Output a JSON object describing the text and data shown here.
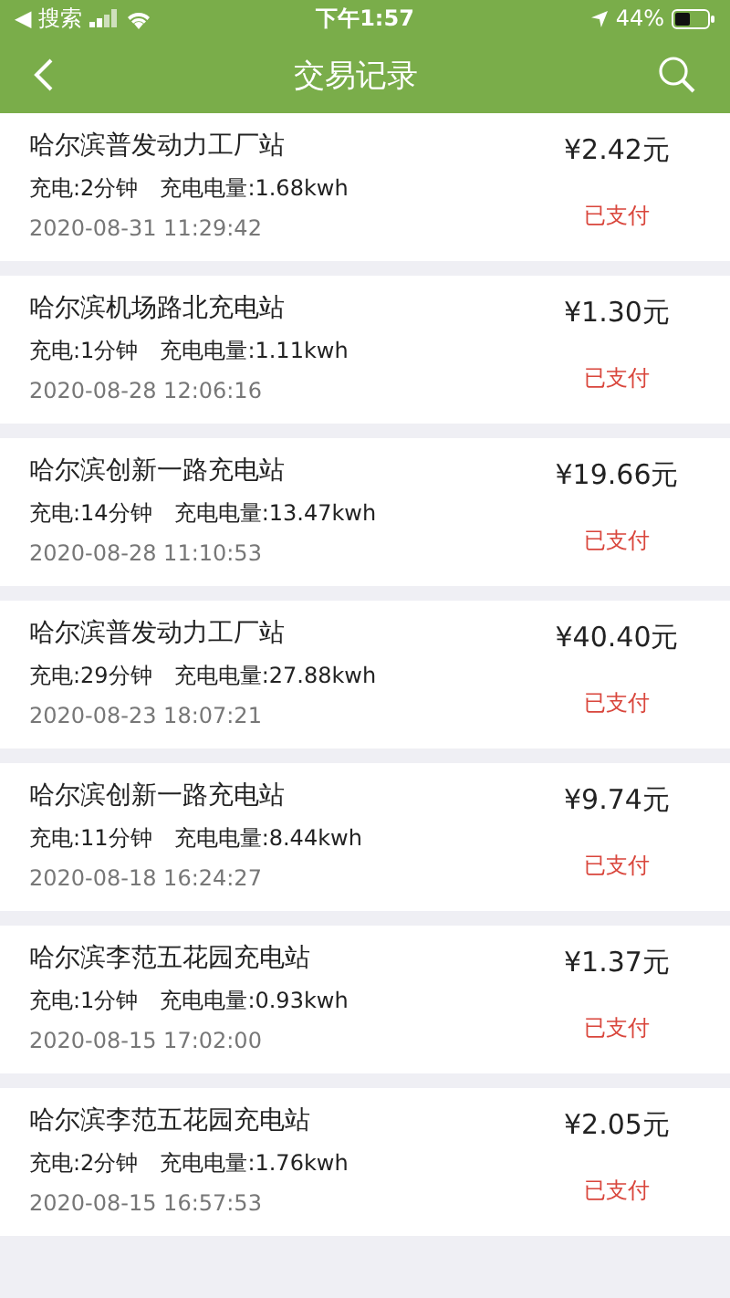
{
  "status_bar": {
    "back_label": "◀ 搜索",
    "time": "下午1:57",
    "battery": "44%"
  },
  "nav": {
    "title": "交易记录"
  },
  "records": [
    {
      "station": "哈尔滨普发动力工厂站",
      "duration": "充电:2分钟",
      "energy": "充电电量:1.68kwh",
      "time": "2020-08-31 11:29:42",
      "amount": "¥2.42元",
      "status": "已支付"
    },
    {
      "station": "哈尔滨机场路北充电站",
      "duration": "充电:1分钟",
      "energy": "充电电量:1.11kwh",
      "time": "2020-08-28 12:06:16",
      "amount": "¥1.30元",
      "status": "已支付"
    },
    {
      "station": "哈尔滨创新一路充电站",
      "duration": "充电:14分钟",
      "energy": "充电电量:13.47kwh",
      "time": "2020-08-28 11:10:53",
      "amount": "¥19.66元",
      "status": "已支付"
    },
    {
      "station": "哈尔滨普发动力工厂站",
      "duration": "充电:29分钟",
      "energy": "充电电量:27.88kwh",
      "time": "2020-08-23 18:07:21",
      "amount": "¥40.40元",
      "status": "已支付"
    },
    {
      "station": "哈尔滨创新一路充电站",
      "duration": "充电:11分钟",
      "energy": "充电电量:8.44kwh",
      "time": "2020-08-18 16:24:27",
      "amount": "¥9.74元",
      "status": "已支付"
    },
    {
      "station": "哈尔滨李范五花园充电站",
      "duration": "充电:1分钟",
      "energy": "充电电量:0.93kwh",
      "time": "2020-08-15 17:02:00",
      "amount": "¥1.37元",
      "status": "已支付"
    },
    {
      "station": "哈尔滨李范五花园充电站",
      "duration": "充电:2分钟",
      "energy": "充电电量:1.76kwh",
      "time": "2020-08-15 16:57:53",
      "amount": "¥2.05元",
      "status": "已支付"
    }
  ]
}
